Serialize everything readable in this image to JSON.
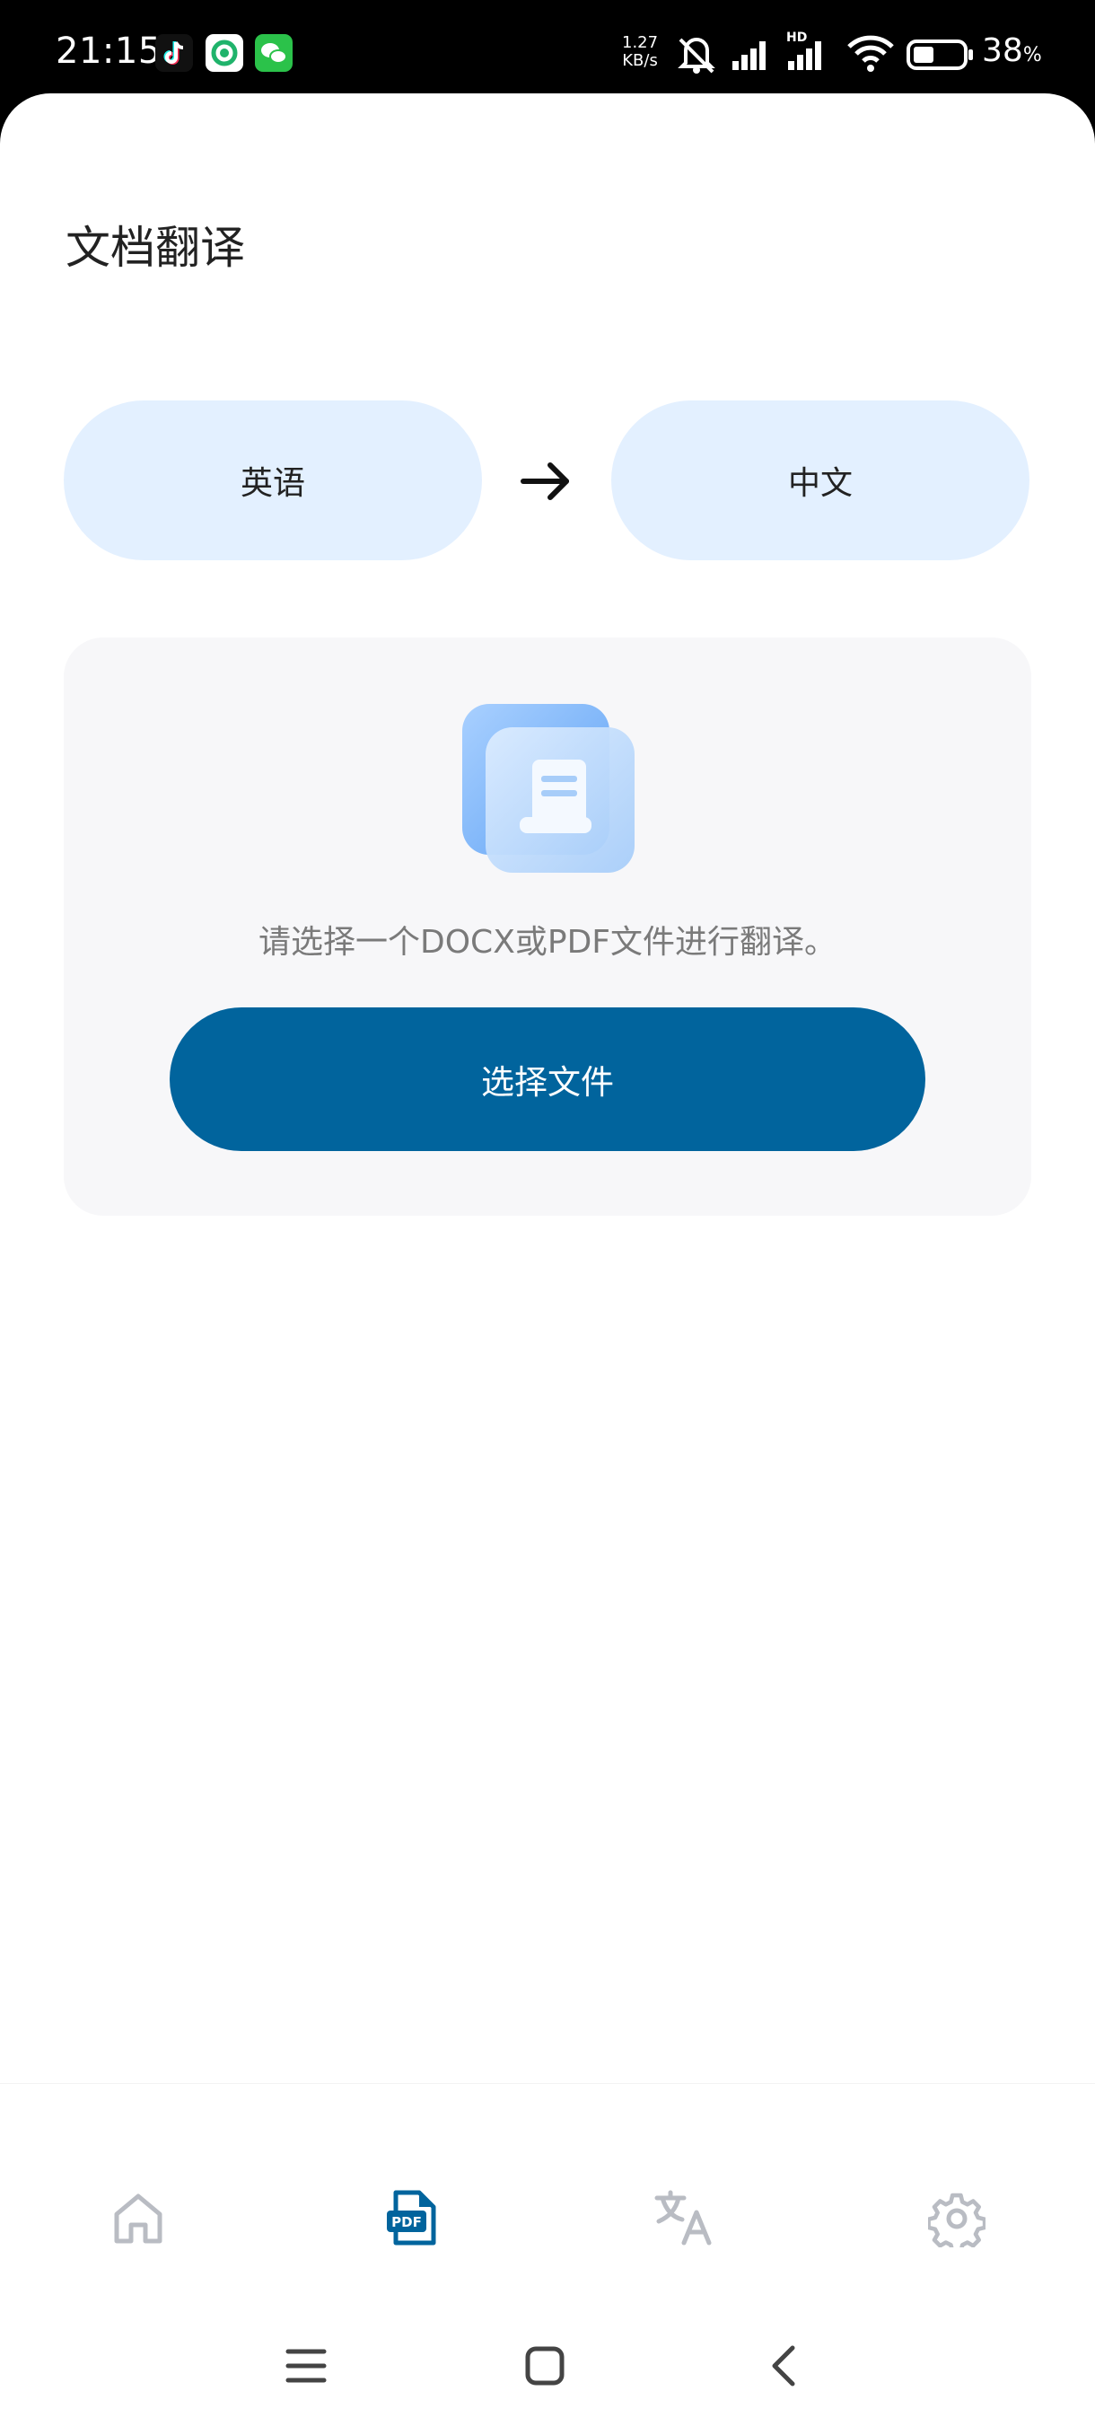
{
  "status_bar": {
    "time": "21:15",
    "net_speed_value": "1.27",
    "net_speed_unit": "KB/s",
    "battery_level": "38",
    "battery_unit": "%",
    "icons": [
      "tiktok-icon",
      "app-icon",
      "wechat-icon",
      "mute-icon",
      "signal-icon",
      "hd-signal-icon",
      "wifi-icon",
      "battery-icon"
    ]
  },
  "page": {
    "title": "文档翻译"
  },
  "languages": {
    "source": "英语",
    "target": "中文",
    "arrow_icon": "arrow-right-icon"
  },
  "upload": {
    "hint": "请选择一个DOCX或PDF文件进行翻译。",
    "button_label": "选择文件"
  },
  "bottom_nav": {
    "items": [
      {
        "icon": "home-icon",
        "active": false
      },
      {
        "icon": "pdf-document-icon",
        "active": true
      },
      {
        "icon": "translate-icon",
        "active": false
      },
      {
        "icon": "gear-icon",
        "active": false
      }
    ],
    "active_color": "#01649d",
    "inactive_color": "#b9bcc3"
  },
  "colors": {
    "primary": "#01649d",
    "pill_bg": "#e3f0ff",
    "card_bg": "#f7f7f9"
  }
}
